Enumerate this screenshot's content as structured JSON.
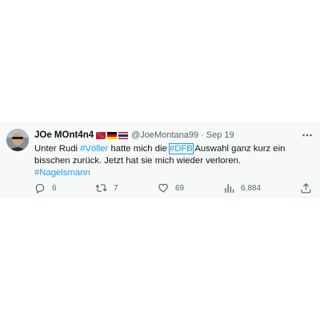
{
  "tweet": {
    "display_name": "JOe MOnt4n4",
    "flags": [
      "trinidad-and-tobago-flag",
      "germany-flag",
      "thailand-flag"
    ],
    "handle": "@JoeMontana99",
    "separator": "·",
    "date": "Sep 19",
    "body": {
      "segment_1": "Unter Rudi ",
      "hashtag_1": "#Völler",
      "segment_2": " hatte mich die ",
      "hashtag_2": "#DFB",
      "segment_3": " Auswahl ganz kurz ein bisschen zurück. Jetzt hat sie mich wieder verloren.",
      "hashtag_3": "#Nagelsmann"
    },
    "stats": {
      "replies": "6",
      "retweets": "7",
      "likes": "69",
      "views": "6,884"
    }
  },
  "colors": {
    "background": "#f7f9f9",
    "text": "#0f1419",
    "secondary_text": "#536471",
    "accent": "#1d9bf0"
  },
  "icons": {
    "more": "more-horizontal-icon",
    "reply": "reply-icon",
    "retweet": "retweet-icon",
    "like": "heart-icon",
    "views": "views-chart-icon",
    "share": "share-icon"
  }
}
